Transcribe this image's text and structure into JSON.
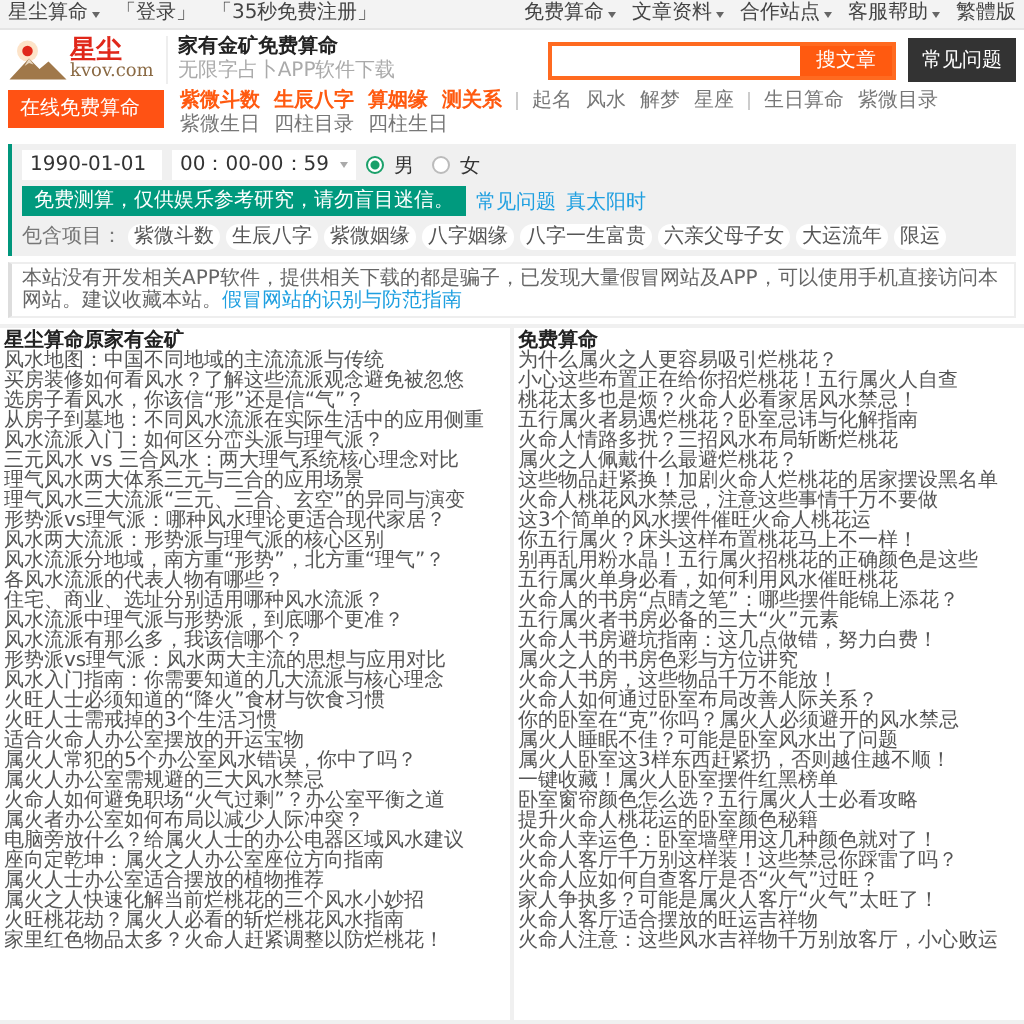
{
  "top_bar": {
    "left": [
      {
        "label": "星尘算命",
        "dropdown": true
      },
      {
        "label": "「登录」",
        "dropdown": false
      },
      {
        "label": "「35秒免费注册」",
        "dropdown": false
      }
    ],
    "right": [
      {
        "label": "免费算命",
        "dropdown": true
      },
      {
        "label": "文章资料",
        "dropdown": true
      },
      {
        "label": "合作站点",
        "dropdown": true
      },
      {
        "label": "客服帮助",
        "dropdown": true
      },
      {
        "label": "繁體版",
        "dropdown": false
      }
    ]
  },
  "header": {
    "logo_text": "星尘",
    "logo_domain": "kvov.com",
    "title": "家有金矿免费算命",
    "subtitle": "无限字占卜APP软件下载",
    "search_button": "搜文章",
    "faq_button": "常见问题"
  },
  "sidebar_tab": "在线免费算命",
  "nav": {
    "groups": [
      [
        {
          "label": "紫微斗数",
          "kind": "hot"
        },
        {
          "label": "生辰八字",
          "kind": "hot"
        },
        {
          "label": "算姻缘",
          "kind": "hot"
        },
        {
          "label": "测关系",
          "kind": "hot"
        }
      ],
      [
        {
          "label": "起名",
          "kind": "plain"
        },
        {
          "label": "风水",
          "kind": "plain"
        },
        {
          "label": "解梦",
          "kind": "plain"
        },
        {
          "label": "星座",
          "kind": "plain"
        }
      ],
      [
        {
          "label": "生日算命",
          "kind": "plain"
        },
        {
          "label": "紫微目录",
          "kind": "plain"
        },
        {
          "label": "紫微生日",
          "kind": "plain"
        },
        {
          "label": "四柱目录",
          "kind": "plain"
        },
        {
          "label": "四柱生日",
          "kind": "plain"
        }
      ]
    ]
  },
  "form": {
    "date": "1990-01-01",
    "time": "00：00-00：59",
    "genders": [
      {
        "label": "男",
        "selected": true
      },
      {
        "label": "女",
        "selected": false
      }
    ],
    "submit": "免费测算，仅供娱乐参考研究，请勿盲目迷信。",
    "links": [
      "常见问题",
      "真太阳时"
    ],
    "includes_label": "包含项目：",
    "includes": [
      "紫微斗数",
      "生辰八字",
      "紫微姻缘",
      "八字姻缘",
      "八字一生富贵",
      "六亲父母子女",
      "大运流年",
      "限运"
    ]
  },
  "notice": {
    "text": "本站没有开发相关APP软件，提供相关下载的都是骗子，已发现大量假冒网站及APP，可以使用手机直接访问本网站。建议收藏本站。",
    "link": "假冒网站的识别与防范指南"
  },
  "columns": [
    {
      "title": "星尘算命原家有金矿",
      "items": [
        "风水地图：中国不同地域的主流流派与传统",
        "买房装修如何看风水？了解这些流派观念避免被忽悠",
        "选房子看风水，你该信“形”还是信“气”？",
        "从房子到墓地：不同风水流派在实际生活中的应用侧重",
        "风水流派入门：如何区分峦头派与理气派？",
        "三元风水 vs 三合风水：两大理气系统核心理念对比",
        "理气风水两大体系三元与三合的应用场景",
        "理气风水三大流派“三元、三合、玄空”的异同与演变",
        "形势派vs理气派：哪种风水理论更适合现代家居？",
        "风水两大流派：形势派与理气派的核心区别",
        "风水流派分地域，南方重“形势”，北方重“理气”？",
        "各风水流派的代表人物有哪些？",
        "住宅、商业、选址分别适用哪种风水流派？",
        "风水流派中理气派与形势派，到底哪个更准？",
        "风水流派有那么多，我该信哪个？",
        "形势派vs理气派：风水两大主流的思想与应用对比",
        "风水入门指南：你需要知道的几大流派与核心理念",
        "火旺人士必须知道的“降火”食材与饮食习惯",
        "火旺人士需戒掉的3个生活习惯",
        "适合火命人办公室摆放的开运宝物",
        "属火人常犯的5个办公室风水错误，你中了吗？",
        "属火人办公室需规避的三大风水禁忌",
        "火命人如何避免职场“火气过剩”？办公室平衡之道",
        "属火者办公室如何布局以减少人际冲突？",
        "电脑旁放什么？给属火人士的办公电器区域风水建议",
        "座向定乾坤：属火之人办公室座位方向指南",
        "属火人士办公室适合摆放的植物推荐",
        "属火之人快速化解当前烂桃花的三个风水小妙招",
        "火旺桃花劫？属火人必看的斩烂桃花风水指南",
        "家里红色物品太多？火命人赶紧调整以防烂桃花！"
      ]
    },
    {
      "title": "免费算命",
      "items": [
        "为什么属火之人更容易吸引烂桃花？",
        "小心这些布置正在给你招烂桃花！五行属火人自查",
        "桃花太多也是烦？火命人必看家居风水禁忌！",
        "五行属火者易遇烂桃花？卧室忌讳与化解指南",
        "火命人情路多扰？三招风水布局斩断烂桃花",
        "属火之人佩戴什么最避烂桃花？",
        "这些物品赶紧换！加剧火命人烂桃花的居家摆设黑名单",
        "火命人桃花风水禁忌，注意这些事情千万不要做",
        "这3个简单的风水摆件催旺火命人桃花运",
        "你五行属火？床头这样布置桃花马上不一样！",
        "别再乱用粉水晶！五行属火招桃花的正确颜色是这些",
        "五行属火单身必看，如何利用风水催旺桃花",
        "火命人的书房“点睛之笔”：哪些摆件能锦上添花？",
        "五行属火者书房必备的三大“火”元素",
        "火命人书房避坑指南：这几点做错，努力白费！",
        "属火之人的书房色彩与方位讲究",
        "火命人书房，这些物品千万不能放！",
        "火命人如何通过卧室布局改善人际关系？",
        "你的卧室在“克”你吗？属火人必须避开的风水禁忌",
        "属火人睡眠不佳？可能是卧室风水出了问题",
        "属火人卧室这3样东西赶紧扔，否则越住越不顺！",
        "一键收藏！属火人卧室摆件红黑榜单",
        "卧室窗帘颜色怎么选？五行属火人士必看攻略",
        "提升火命人桃花运的卧室颜色秘籍",
        "火命人幸运色：卧室墙壁用这几种颜色就对了！",
        "火命人客厅千万别这样装！这些禁忌你踩雷了吗？",
        "火命人应如何自查客厅是否“火气”过旺？",
        "家人争执多？可能是属火人客厅“火气”太旺了！",
        "火命人客厅适合摆放的旺运吉祥物",
        "火命人注意：这些风水吉祥物千万别放客厅，小心败运"
      ]
    }
  ]
}
